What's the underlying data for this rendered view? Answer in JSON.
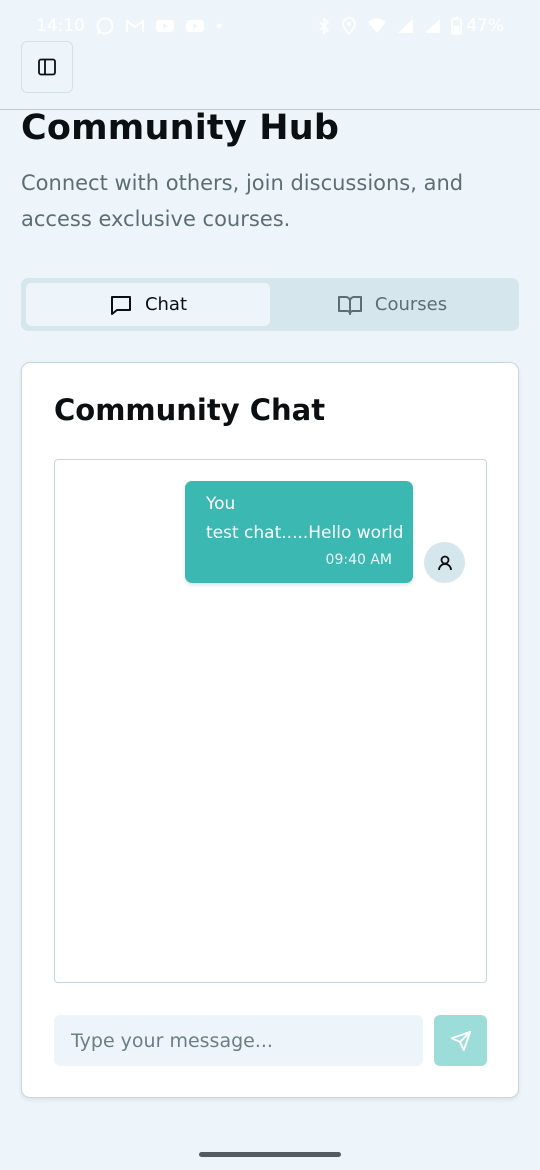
{
  "status_bar": {
    "time": "14:10",
    "battery": "47%",
    "left_icons": [
      "whatsapp-icon",
      "gmail-icon",
      "youtube-icon",
      "youtube-icon",
      "dot-icon"
    ],
    "right_icons": [
      "bluetooth-icon",
      "location-icon",
      "wifi-icon",
      "signal-icon",
      "signal-icon",
      "battery-icon"
    ]
  },
  "header": {
    "toggle_icon": "sidebar-toggle-icon"
  },
  "page": {
    "title": "Community Hub",
    "subtitle": "Connect with others, join discussions, and access exclusive courses."
  },
  "tabs": [
    {
      "label": "Chat",
      "icon": "message-square-icon",
      "active": true
    },
    {
      "label": "Courses",
      "icon": "book-open-icon",
      "active": false
    }
  ],
  "chat": {
    "title": "Community Chat",
    "messages": [
      {
        "sender": "You",
        "text": "test chat.....Hello world",
        "time": "09:40 AM",
        "avatar_icon": "user-icon"
      }
    ],
    "input_placeholder": "Type your message...",
    "send_icon": "send-icon"
  },
  "colors": {
    "background": "#eef5fa",
    "accent": "#3cb8b2",
    "send_disabled": "#9dddd9",
    "tab_track": "#d6e6ed"
  }
}
